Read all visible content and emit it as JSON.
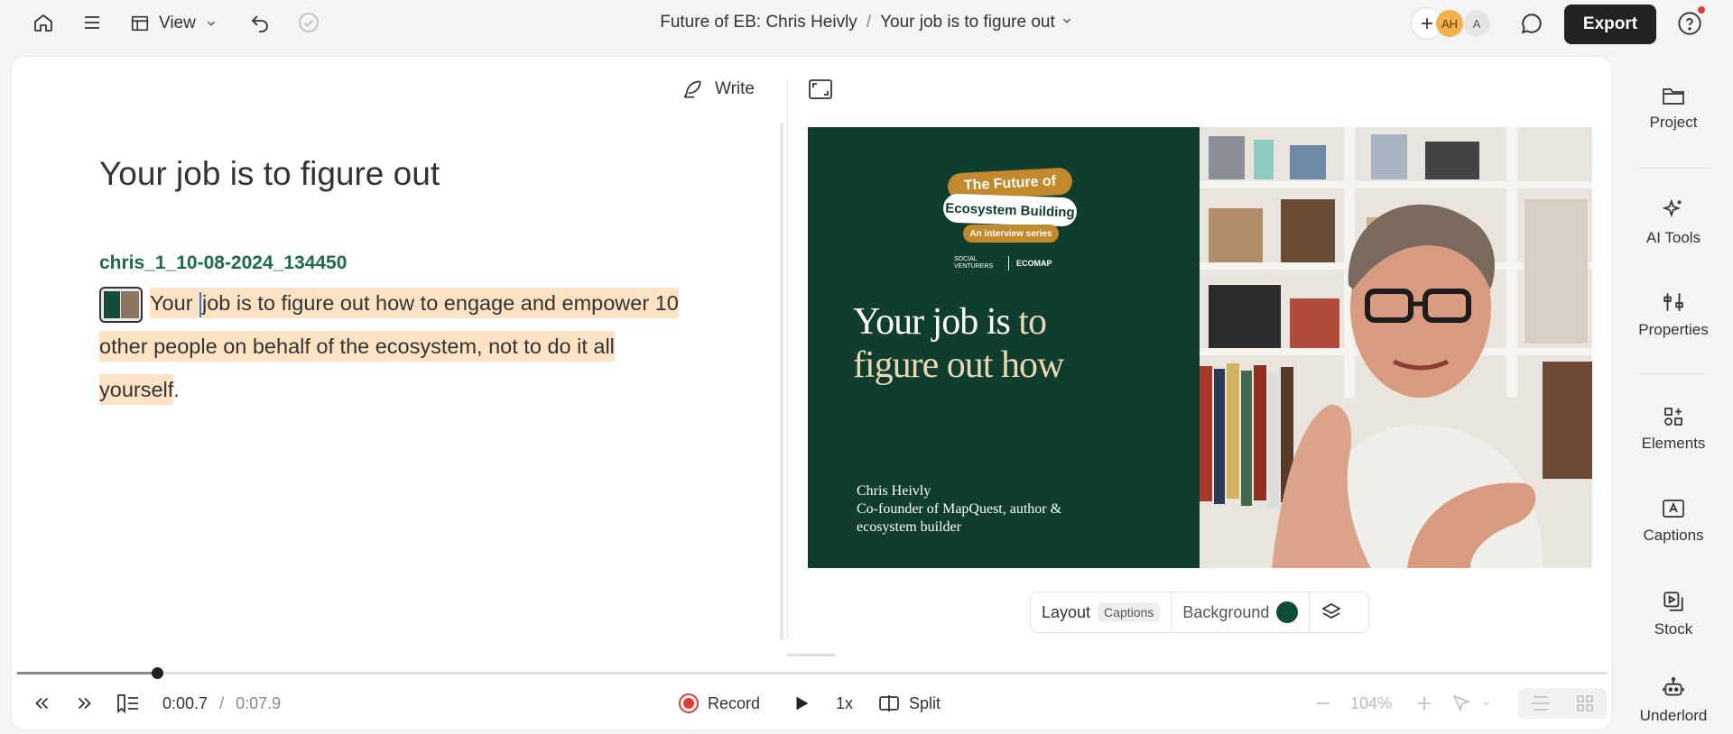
{
  "topbar": {
    "view_label": "View",
    "project_title": "Future of EB: Chris Heivly",
    "separator": "/",
    "composition_title": "Your job is to figure out",
    "avatar_1": "AH",
    "avatar_2": "A",
    "export_label": "Export"
  },
  "editor": {
    "write_label": "Write",
    "doc_title": "Your job is to figure out",
    "speaker": "chris_1_10-08-2024_134450",
    "transcript_part1": "Your ",
    "transcript_part2": "job is to figure out how to engage and empower 10 other people on behalf of the ecosystem, not to do it all yourself",
    "transcript_end": "."
  },
  "preview": {
    "badge_line1": "The Future of",
    "badge_line2": "Ecosystem Building",
    "badge_line3": "An interview series",
    "logo_1": "SOCIAL VENTURERS",
    "logo_2": "ECOMAP",
    "quote_line1_a": "Your job is",
    "quote_line1_b": "to",
    "quote_line2": "figure out how",
    "name_line1": "Chris Heivly",
    "name_line2": "Co-founder of MapQuest, author &",
    "name_line3": "ecosystem builder",
    "layout_label": "Layout",
    "layout_tag": "Captions",
    "background_label": "Background",
    "background_color": "#0f4d3a"
  },
  "playback": {
    "current_time": "0:00.7",
    "time_sep": "/",
    "total_time": "0:07.9",
    "progress": 0.088,
    "record_label": "Record",
    "speed_label": "1x",
    "split_label": "Split",
    "zoom_label": "104%"
  },
  "rail": {
    "project": "Project",
    "ai_tools": "AI Tools",
    "properties": "Properties",
    "elements": "Elements",
    "captions": "Captions",
    "stock": "Stock",
    "underlord": "Underlord"
  },
  "colors": {
    "accent_green": "#1d6b46",
    "highlight": "#fde3c3",
    "record_red": "#e53935"
  }
}
